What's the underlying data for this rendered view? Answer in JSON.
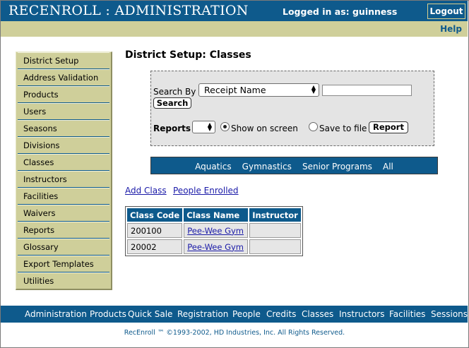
{
  "header": {
    "app_title": "RECENROLL : ADMINISTRATION",
    "logged_in": "Logged in as: guinness",
    "logout_label": "Logout",
    "help_label": "Help"
  },
  "sidebar": {
    "items": [
      {
        "label": "District Setup"
      },
      {
        "label": "Address Validation"
      },
      {
        "label": "Products"
      },
      {
        "label": "Users"
      },
      {
        "label": "Seasons"
      },
      {
        "label": "Divisions"
      },
      {
        "label": "Classes"
      },
      {
        "label": "Instructors"
      },
      {
        "label": "Facilities"
      },
      {
        "label": "Waivers"
      },
      {
        "label": "Reports"
      },
      {
        "label": "Glossary"
      },
      {
        "label": "Export Templates"
      },
      {
        "label": "Utilities"
      }
    ]
  },
  "main": {
    "page_title": "District Setup: Classes",
    "search": {
      "search_by_label": "Search By",
      "search_by_value": "Receipt Name",
      "search_text_value": "",
      "search_button": "Search",
      "reports_label": "Reports",
      "reports_value": "",
      "show_on_screen_label": "Show on screen",
      "show_on_screen_selected": true,
      "save_to_file_label": "Save to file",
      "save_to_file_selected": false,
      "report_button": "Report"
    },
    "categories": [
      "Aquatics",
      "Gymnastics",
      "Senior Programs",
      "All"
    ],
    "actions": {
      "add_class": "Add Class",
      "people_enrolled": "People Enrolled"
    },
    "table": {
      "headers": [
        "Class Code",
        "Class Name",
        "Instructor"
      ],
      "rows": [
        {
          "code": "200100",
          "name": "Pee-Wee Gym",
          "instructor": ""
        },
        {
          "code": "20002",
          "name": "Pee-Wee Gym",
          "instructor": ""
        }
      ]
    }
  },
  "footer": {
    "links": [
      "Administration",
      "Products",
      "Quick Sale",
      "Registration",
      "People",
      "Credits",
      "Classes",
      "Instructors",
      "Facilities",
      "Sessions"
    ],
    "copyright": "RecEnroll ™ ©1993-2002, HD Industries, Inc.  All Rights Reserved."
  },
  "colors": {
    "brand_blue": "#0e5a8c",
    "khaki": "#cfcf9a",
    "link_blue": "#1a1aa8"
  }
}
